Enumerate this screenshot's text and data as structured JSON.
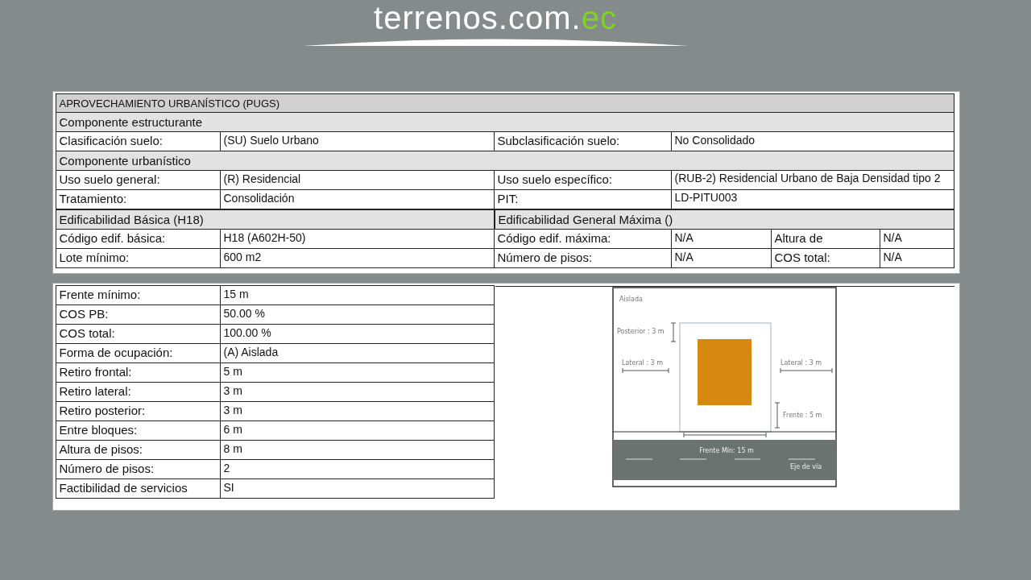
{
  "logo": {
    "text": "terrenos.com.",
    "accent": "ec"
  },
  "zoning": {
    "title": "APROVECHAMIENTO URBANÍSTICO (PUGS)",
    "structural_heading": "Componente  estructurante",
    "classification": {
      "label": "Clasificación suelo:",
      "value": "(SU) Suelo Urbano"
    },
    "subclassification": {
      "label": "Subclasificación suelo:",
      "value": "No Consolidado"
    },
    "urban_heading": "Componente  urbanístico",
    "urban_left": [
      {
        "label": "Uso suelo general:",
        "value": "(R) Residencial"
      },
      {
        "label": "Tratamiento:",
        "value": "Consolidación"
      }
    ],
    "urban_right": [
      {
        "label": "Uso suelo específico:",
        "value": "(RUB-2) Residencial Urbano de Baja Densidad tipo 2"
      },
      {
        "label": "PIT:",
        "value": "LD-PITU003"
      }
    ],
    "basic": {
      "heading": "Edificabilidad Básica (H18)",
      "rows": [
        {
          "label": "Código edif. básica:",
          "value": "H18 (A602H-50)"
        },
        {
          "label": "Lote mínimo:",
          "value": "600 m2"
        }
      ]
    },
    "maximum": {
      "heading": "Edificabilidad General Máxima ()",
      "rows": [
        {
          "label": "Código edif. máxima:",
          "value": "N/A",
          "label_2": "Altura de",
          "value_2": "N/A"
        },
        {
          "label": "Número de pisos:",
          "value": "N/A",
          "label_2": "COS total:",
          "value_2": "N/A"
        }
      ]
    }
  },
  "parameters": [
    {
      "label": "Frente mínimo:",
      "value": "15 m"
    },
    {
      "label": "COS PB:",
      "value": "50.00 %"
    },
    {
      "label": "COS total:",
      "value": "100.00 %"
    },
    {
      "label": "Forma de ocupación:",
      "value": "(A) Aislada"
    },
    {
      "label": "Retiro frontal:",
      "value": "5 m"
    },
    {
      "label": "Retiro lateral:",
      "value": "3 m"
    },
    {
      "label": "Retiro posterior:",
      "value": "3 m"
    },
    {
      "label": "Entre bloques:",
      "value": "6 m"
    },
    {
      "label": "Altura de pisos:",
      "value": "8 m"
    },
    {
      "label": "Número de pisos:",
      "value": "2"
    },
    {
      "label": "Factibilidad de servicios",
      "value": "SI"
    }
  ],
  "diagram": {
    "title": "Aislada",
    "posterior": "Posterior : 3 m",
    "lateral_left": "Lateral : 3 m",
    "lateral_right": "Lateral : 3 m",
    "front": "Frente : 5 m",
    "front_min": "Frente Mín: 15 m",
    "axis": "Eje de vía"
  }
}
